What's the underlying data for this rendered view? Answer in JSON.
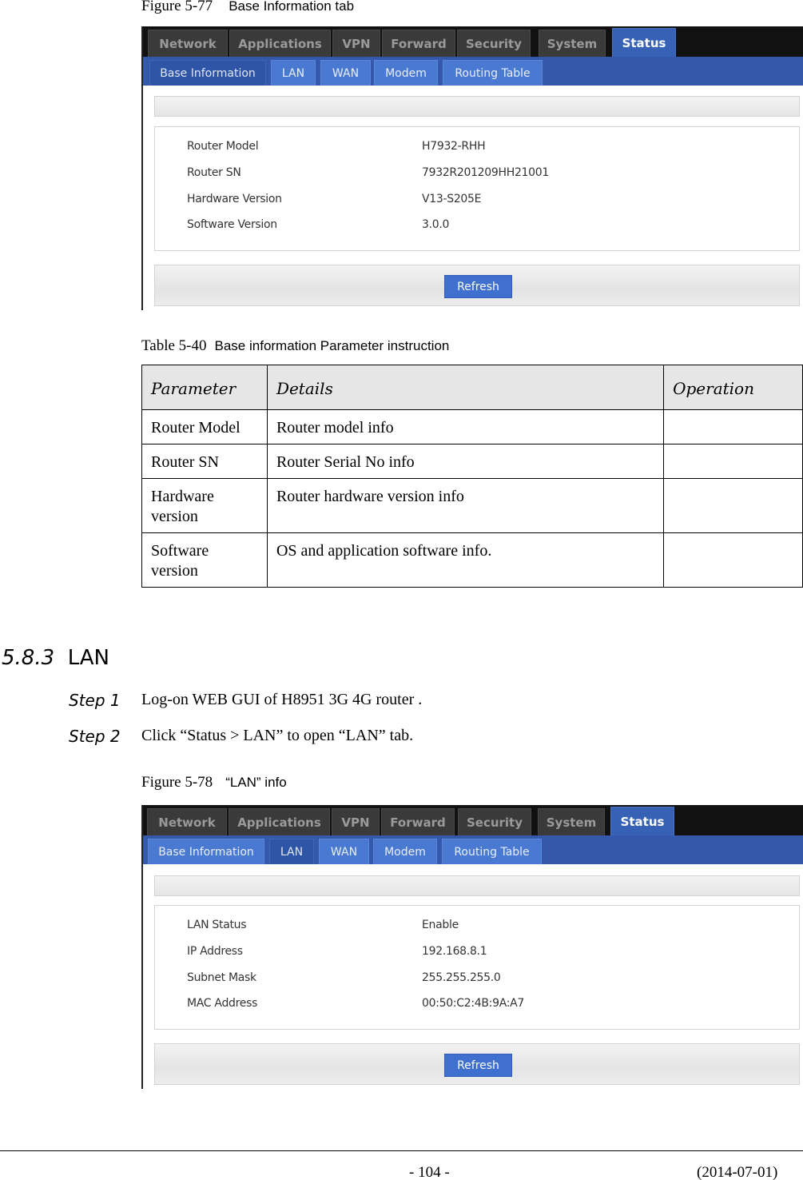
{
  "figure1": {
    "number": "Figure 5-77",
    "title": "Base Information tab"
  },
  "router_ui_1": {
    "main_tabs": [
      {
        "label": "Network",
        "active": false
      },
      {
        "label": "Applications",
        "active": false
      },
      {
        "label": "VPN",
        "active": false
      },
      {
        "label": "Forward",
        "active": false
      },
      {
        "label": "Security",
        "active": false
      },
      {
        "label": "System",
        "active": false
      },
      {
        "label": "Status",
        "active": true
      }
    ],
    "sub_tabs": [
      {
        "label": "Base Information",
        "active": true
      },
      {
        "label": "LAN",
        "active": false
      },
      {
        "label": "WAN",
        "active": false
      },
      {
        "label": "Modem",
        "active": false
      },
      {
        "label": "Routing Table",
        "active": false
      }
    ],
    "rows": [
      {
        "label": "Router Model",
        "value": "H7932-RHH"
      },
      {
        "label": "Router SN",
        "value": "7932R201209HH21001"
      },
      {
        "label": "Hardware Version",
        "value": "V13-S205E"
      },
      {
        "label": "Software Version",
        "value": "3.0.0"
      }
    ],
    "refresh_label": "Refresh"
  },
  "table1": {
    "caption_number": "Table 5-40",
    "caption_title": "Base information Parameter instruction",
    "headers": [
      "Parameter",
      "Details",
      "Operation"
    ],
    "rows": [
      {
        "parameter": "Router Model",
        "details": "Router model info",
        "operation": ""
      },
      {
        "parameter": "Router SN",
        "details": "Router Serial No info",
        "operation": ""
      },
      {
        "parameter": "Hardware version",
        "details": "Router hardware version info",
        "operation": ""
      },
      {
        "parameter": "Software version",
        "details": "OS and application software info.",
        "operation": ""
      }
    ]
  },
  "section": {
    "number": "5.8.3",
    "title": "LAN"
  },
  "steps": [
    {
      "label": "Step 1",
      "text": "Log-on WEB GUI of H8951 3G 4G router ."
    },
    {
      "label": "Step 2",
      "text": "Click “Status > LAN” to open “LAN” tab."
    }
  ],
  "figure2": {
    "number": "Figure 5-78",
    "title": "“LAN”  info"
  },
  "router_ui_2": {
    "main_tabs": [
      {
        "label": "Network",
        "active": false
      },
      {
        "label": "Applications",
        "active": false
      },
      {
        "label": "VPN",
        "active": false
      },
      {
        "label": "Forward",
        "active": false
      },
      {
        "label": "Security",
        "active": false
      },
      {
        "label": "System",
        "active": false
      },
      {
        "label": "Status",
        "active": true
      }
    ],
    "sub_tabs": [
      {
        "label": "Base Information",
        "active": false
      },
      {
        "label": "LAN",
        "active": true
      },
      {
        "label": "WAN",
        "active": false
      },
      {
        "label": "Modem",
        "active": false
      },
      {
        "label": "Routing Table",
        "active": false
      }
    ],
    "rows": [
      {
        "label": "LAN Status",
        "value": "Enable"
      },
      {
        "label": "IP Address",
        "value": "192.168.8.1"
      },
      {
        "label": "Subnet Mask",
        "value": "255.255.255.0"
      },
      {
        "label": "MAC Address",
        "value": "00:50:C2:4B:9A:A7"
      }
    ],
    "refresh_label": "Refresh"
  },
  "footer": {
    "page": "- 104 -",
    "date": "(2014-07-01)"
  }
}
